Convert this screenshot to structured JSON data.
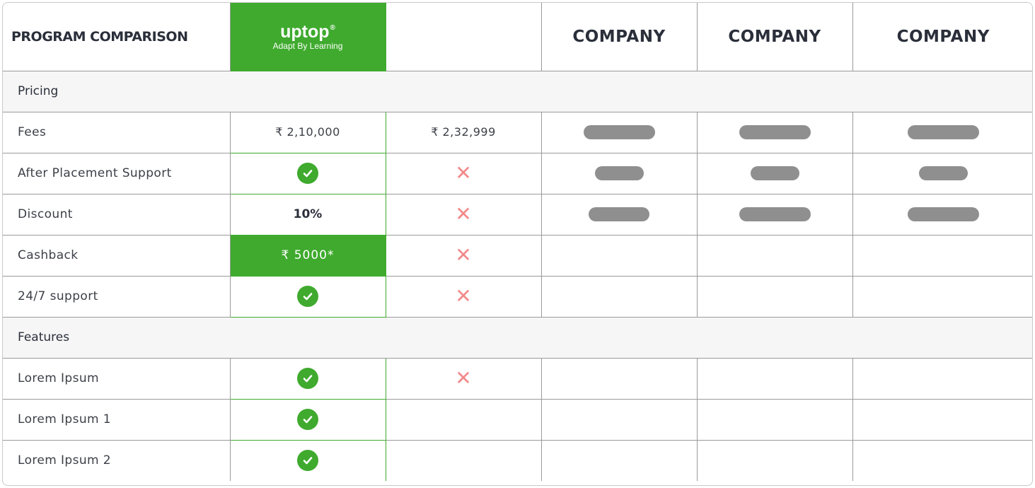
{
  "header": {
    "title": "PROGRAM COMPARISON",
    "brand_name": "uptop",
    "brand_mark": "®",
    "brand_tagline": "Adapt By Learning",
    "companies": [
      "COMPANY",
      "COMPANY",
      "COMPANY"
    ]
  },
  "sections": {
    "pricing": "Pricing",
    "features": "Features"
  },
  "rows": {
    "fees": {
      "label": "Fees",
      "uptop": "₹ 2,10,000",
      "competitor": "₹ 2,32,999"
    },
    "after_placement": {
      "label": "After Placement Support"
    },
    "discount": {
      "label": "Discount",
      "uptop": "10%"
    },
    "cashback": {
      "label": "Cashback",
      "uptop": "₹ 5000*"
    },
    "support": {
      "label": "24/7 support"
    },
    "lorem": {
      "label": "Lorem Ipsum"
    },
    "lorem1": {
      "label": "Lorem Ipsum 1"
    },
    "lorem2": {
      "label": "Lorem Ipsum 2"
    }
  },
  "icons": {
    "check": "check-circle-icon",
    "cross": "cross-icon",
    "cross_glyph": "✕"
  },
  "colors": {
    "brand_green": "#3faa2e",
    "cross_red": "#f28a8a",
    "placeholder_gray": "#8f8f8f",
    "section_bg": "#f6f6f6"
  }
}
